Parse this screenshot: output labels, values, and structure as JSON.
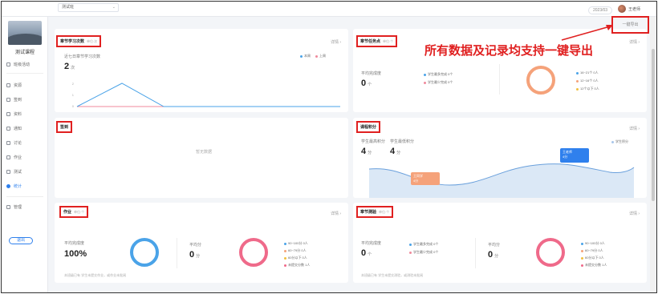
{
  "header": {
    "date": "2023/03",
    "user": "王老师"
  },
  "sidebar": {
    "course_title": "测试课程",
    "top_item": "班级活动",
    "items": [
      {
        "label": "资源",
        "active": false
      },
      {
        "label": "签到",
        "active": false
      },
      {
        "label": "资料",
        "active": false
      },
      {
        "label": "通知",
        "active": false
      },
      {
        "label": "讨论",
        "active": false
      },
      {
        "label": "作业",
        "active": false
      },
      {
        "label": "测试",
        "active": false
      },
      {
        "label": "统计",
        "active": true
      }
    ],
    "bottom_item": "管理",
    "button": "退出"
  },
  "toolbar": {
    "filter_value": "测试班",
    "export_label": "一键导出"
  },
  "annotation": "所有数据及记录均支持一键导出",
  "cards": {
    "study_count": {
      "title": "章节学习次数",
      "sub": "单位:次",
      "detail": "详情 ›",
      "label": "近七日章节学习次数",
      "value": "2",
      "unit": "次",
      "legend": [
        "本周",
        "上周"
      ]
    },
    "task_completion": {
      "title": "章节任务点",
      "sub": "单位:个",
      "detail": "详情 ›",
      "label": "平均完成度",
      "value": "0",
      "unit": "个",
      "mid_legend": [
        "学生最多完成  0个",
        "学生最少完成  0个"
      ],
      "right_legend": [
        "16~21个  0人",
        "12~16个  0人",
        "12个以下  0人"
      ]
    },
    "attendance": {
      "title": "签到",
      "empty": "暂无数据"
    },
    "course_points": {
      "title": "课程积分",
      "detail": "详情 ›",
      "label1": "学生最高积分",
      "value1": "4",
      "unit1": "分",
      "label2": "学生最低积分",
      "value2": "4",
      "unit2": "分",
      "legend": "学生积分",
      "marker_high": {
        "name": "王老师",
        "value": "4分"
      },
      "marker_low": {
        "name": "王同学",
        "value": "4分"
      }
    },
    "homework": {
      "title": "作业",
      "sub": "单位:个",
      "detail": "详情 ›",
      "label": "平均完成度",
      "value": "100%",
      "label2": "平均分",
      "value2": "0",
      "unit2": "分",
      "footnote": "本班级已有 学生未提交作业，或作业未批阅",
      "legend": [
        "90~100分  0人",
        "60~79分  0人",
        "60分以下  0人",
        "未提交分数  1人"
      ],
      "completion_fraction": 1.0
    },
    "chapter_test": {
      "title": "章节测验",
      "sub": "单位:个",
      "detail": "详情 ›",
      "label": "平均完成度",
      "value": "0",
      "unit": "个",
      "mid_legend": [
        "学生最多完成  0个",
        "学生最少完成  0个"
      ],
      "label2": "平均分",
      "value2": "0",
      "unit2": "分",
      "footnote": "本班级已有 学生未提交测验，或测验未批阅",
      "legend": [
        "90~100分  0人",
        "60~79分  0人",
        "60分以下  0人",
        "未提交分数  1人"
      ]
    }
  },
  "colors": {
    "accent": "#2f80ed",
    "annotation": "#e02020",
    "ring_orange": "#f5a27a",
    "ring_pink": "#ef6a8a",
    "ring_blue": "#4aa3e8"
  }
}
